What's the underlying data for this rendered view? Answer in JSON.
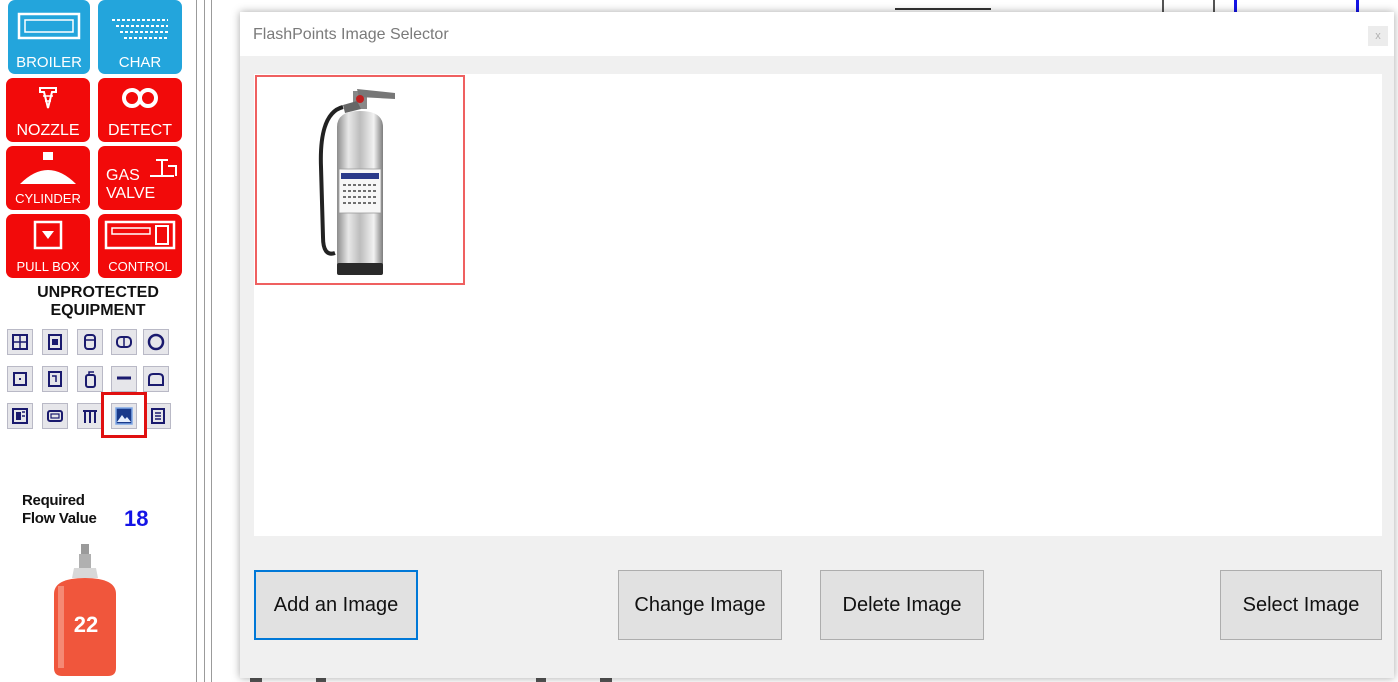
{
  "toolbox": {
    "top_buttons": [
      {
        "id": "broiler",
        "label": "BROILER",
        "color": "#23a5dc"
      },
      {
        "id": "char",
        "label": "CHAR",
        "color": "#23a5dc"
      }
    ],
    "red_buttons": {
      "nozzle": "NOZZLE",
      "detect": "DETECT",
      "cylinder": "CYLINDER",
      "gas_valve_line1": "GAS",
      "gas_valve_line2": "VALVE",
      "pull_box": "PULL BOX",
      "control": "CONTROL"
    },
    "unprotected_line1": "UNPROTECTED",
    "unprotected_line2": "EQUIPMENT",
    "selected_equipment_icon": "image-icon",
    "required_label_line1": "Required",
    "required_label_line2": "Flow Value",
    "required_value": "18",
    "tank_number": "22",
    "colors": {
      "blue": "#23a5dc",
      "red": "#f20a0a",
      "value": "#1414e6",
      "tank": "#f0563c"
    }
  },
  "dialog": {
    "title": "FlashPoints Image Selector",
    "close_label": "x",
    "images": [
      {
        "name": "fire-extinguisher",
        "selected": true
      }
    ],
    "buttons": {
      "add": "Add an Image",
      "change": "Change Image",
      "delete": "Delete Image",
      "select": "Select Image"
    }
  }
}
